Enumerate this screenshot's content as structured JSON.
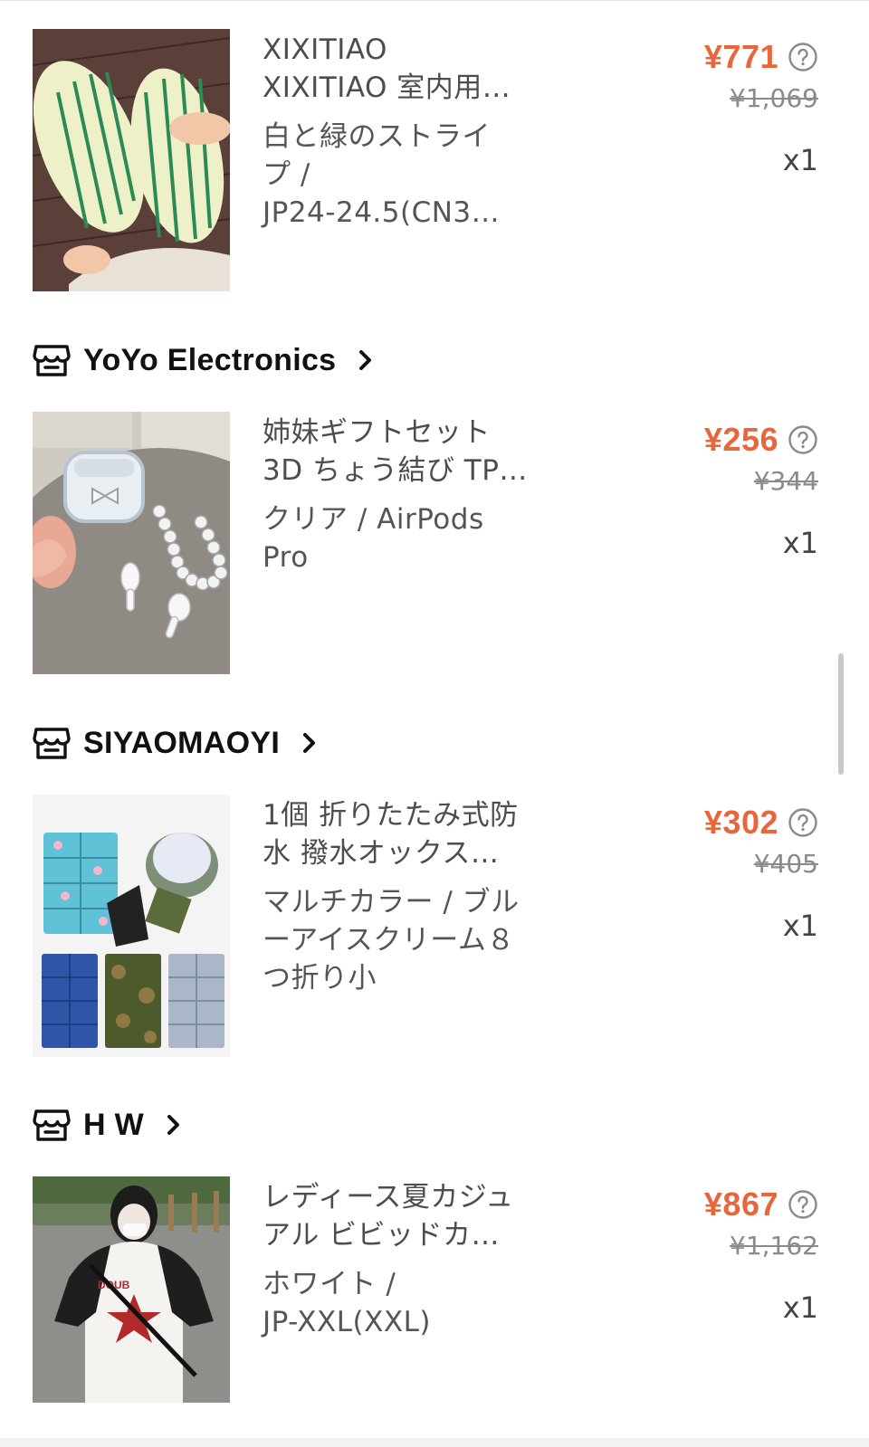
{
  "icons": {
    "store": "store-icon",
    "chevron": "chevron-right-icon",
    "help": "question-circle-icon"
  },
  "colors": {
    "price": "#e8663c",
    "original_price": "#8a8a8a",
    "text": "#1a1a1a"
  },
  "stores": [
    {
      "name": "YoYo Electronics"
    },
    {
      "name": "SIYAOMAOYI"
    },
    {
      "name": "H W"
    }
  ],
  "products": [
    {
      "image": "striped-slippers-photo",
      "title_lines": [
        "XIXITIAO",
        "XIXITIAO 室内用…"
      ],
      "variant_lines": [
        "白と緑のストライ",
        "プ /",
        "JP24-24.5(CN3…"
      ],
      "price": "¥771",
      "original_price": "¥1,069",
      "quantity": "x1"
    },
    {
      "image": "airpods-case-photo",
      "title_lines": [
        "姉妹ギフトセット",
        "3D ちょう結び TP…"
      ],
      "variant_lines": [
        "クリア / AirPods",
        "Pro"
      ],
      "price": "¥256",
      "original_price": "¥344",
      "quantity": "x1"
    },
    {
      "image": "foldable-cushion-photo",
      "title_lines": [
        "1個 折りたたみ式防",
        "水 撥水オックス…"
      ],
      "variant_lines": [
        "マルチカラー / ブル",
        "ーアイスクリーム８",
        "つ折り小"
      ],
      "price": "¥302",
      "original_price": "¥405",
      "quantity": "x1"
    },
    {
      "image": "raglan-tshirt-photo",
      "title_lines": [
        "レディース夏カジュ",
        "アル ビビッドカ…"
      ],
      "variant_lines": [
        "ホワイト /",
        "JP-XXL(XXL)"
      ],
      "price": "¥867",
      "original_price": "¥1,162",
      "quantity": "x1"
    }
  ]
}
